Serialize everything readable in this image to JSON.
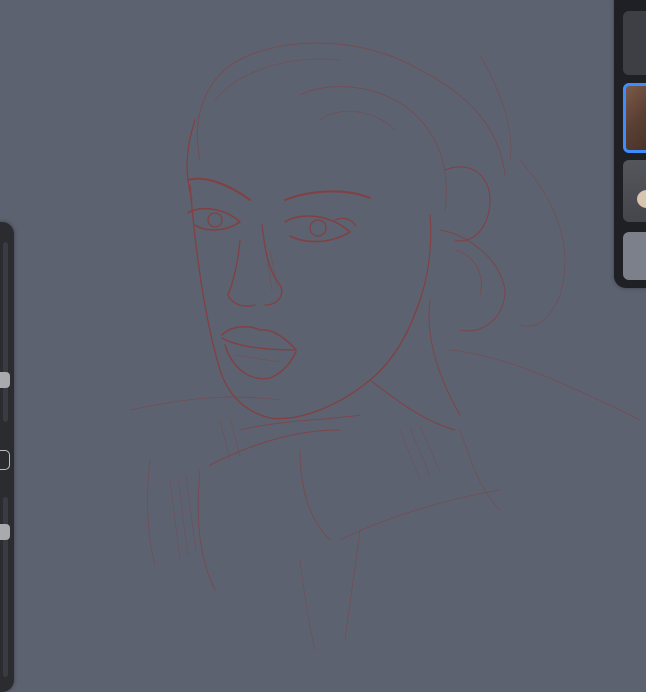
{
  "app": {
    "canvas_background": "#5d6270",
    "sketch_color": "#8a3a3a",
    "accent_color": "#3f8cff"
  },
  "left_sidebar": {
    "brush_size_slider": {
      "icon": "slider-icon"
    },
    "opacity_slider": {
      "icon": "slider-icon"
    },
    "undo_button": {
      "icon": "undo-icon"
    }
  },
  "layer_panel": {
    "layers": [
      {
        "thumbnail": "empty-layer",
        "selected": false
      },
      {
        "thumbnail": "portrait-color-layer",
        "selected": true
      },
      {
        "thumbnail": "figure-layer",
        "selected": false
      },
      {
        "thumbnail": "background-layer",
        "selected": false
      }
    ]
  }
}
